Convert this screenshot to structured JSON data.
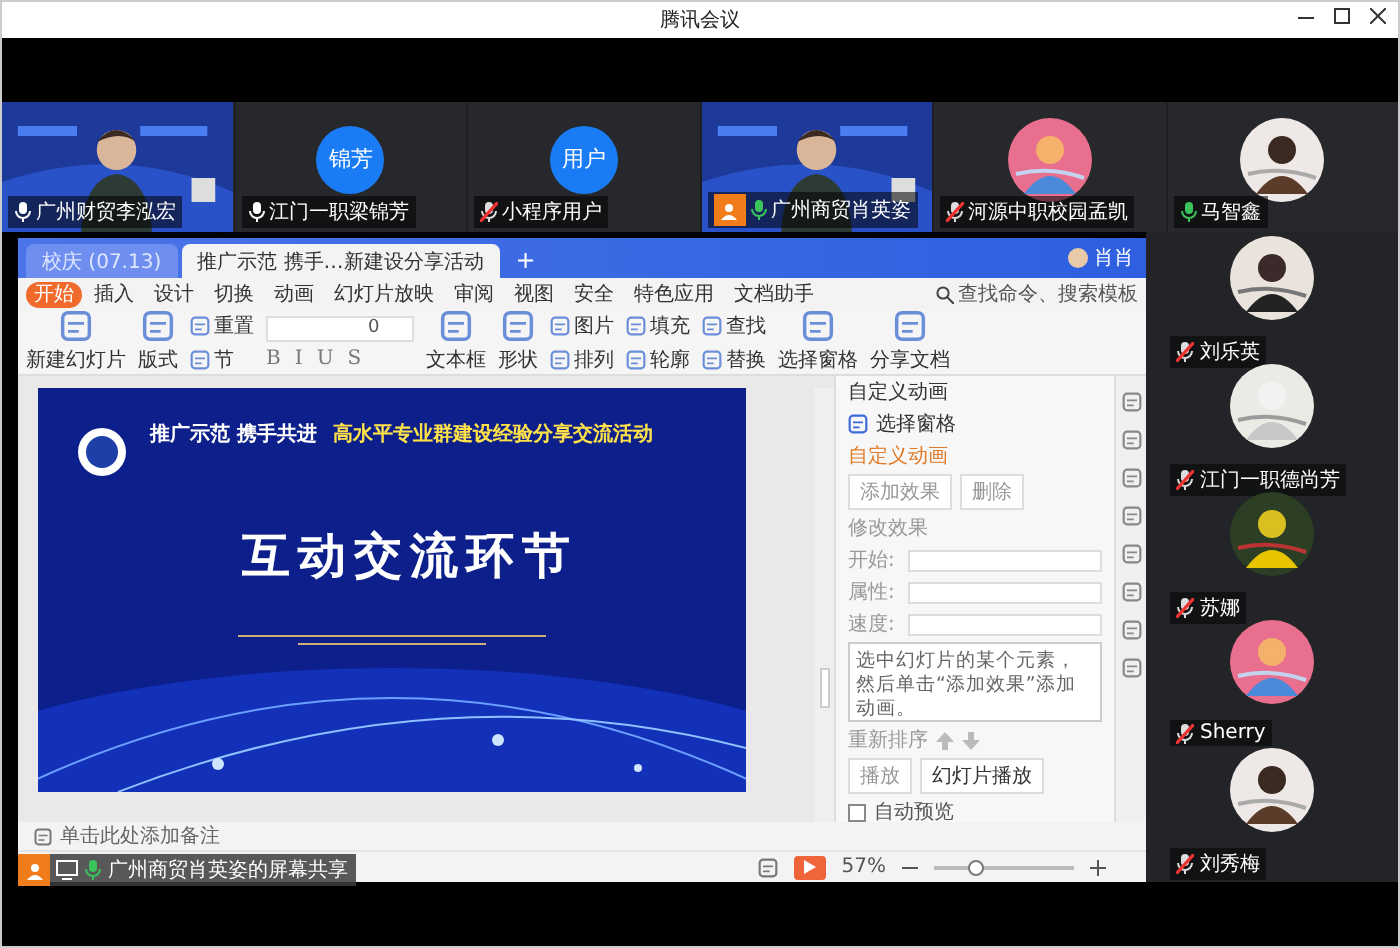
{
  "window": {
    "title": "腾讯会议"
  },
  "top_participants": [
    {
      "name": "广州财贸李泓宏",
      "kind": "video",
      "muted": false,
      "speaking": false,
      "host": false
    },
    {
      "name": "江门一职梁锦芳",
      "kind": "initials",
      "initials": "锦芳",
      "muted": false,
      "speaking": false,
      "host": false
    },
    {
      "name": "小程序用户",
      "kind": "initials",
      "initials": "用户",
      "muted": true,
      "speaking": false,
      "host": false
    },
    {
      "name": "广州商贸肖英姿",
      "kind": "video",
      "muted": false,
      "speaking": true,
      "host": true
    },
    {
      "name": "河源中职校园孟凯",
      "muted": true,
      "speaking": false,
      "host": false
    },
    {
      "name": "马智鑫",
      "muted": false,
      "speaking": true,
      "host": false
    }
  ],
  "wps": {
    "tabs": [
      {
        "label": "校庆 (07.13)",
        "selected": false
      },
      {
        "label": "推广示范 携手…新建设分享活动",
        "selected": true
      }
    ],
    "new_tab": "+",
    "user": "肖肖",
    "menu": [
      {
        "label": "开始",
        "selected": true
      },
      {
        "label": "插入",
        "selected": false
      },
      {
        "label": "设计",
        "selected": false
      },
      {
        "label": "切换",
        "selected": false
      },
      {
        "label": "动画",
        "selected": false
      },
      {
        "label": "幻灯片放映",
        "selected": false
      },
      {
        "label": "审阅",
        "selected": false
      },
      {
        "label": "视图",
        "selected": false
      },
      {
        "label": "安全",
        "selected": false
      },
      {
        "label": "特色应用",
        "selected": false
      },
      {
        "label": "文档助手",
        "selected": false
      }
    ],
    "search": {
      "placeholder": "查找命令、搜索模板"
    },
    "toolbar": [
      {
        "kind": "large",
        "label": "新建幻灯片"
      },
      {
        "kind": "large",
        "label": "版式"
      },
      {
        "kind": "pair",
        "labels": [
          "重置",
          "节"
        ]
      },
      {
        "kind": "font",
        "size": "0",
        "styles": [
          "B",
          "I",
          "U",
          "S"
        ]
      },
      {
        "kind": "large",
        "label": "文本框"
      },
      {
        "kind": "large",
        "label": "形状"
      },
      {
        "kind": "pair",
        "labels": [
          "图片",
          "排列"
        ]
      },
      {
        "kind": "pair",
        "labels": [
          "填充",
          "轮廓"
        ]
      },
      {
        "kind": "pair",
        "labels": [
          "查找",
          "替换"
        ]
      },
      {
        "kind": "large",
        "label": "选择窗格"
      },
      {
        "kind": "large",
        "label": "分享文档"
      }
    ],
    "slide": {
      "header_left": "推广示范  携手共进",
      "header_right": "高水平专业群建设经验分享交流活动",
      "title": "互动交流环节"
    },
    "notes": {
      "placeholder": "单击此处添加备注"
    },
    "zoom": {
      "reading": "57%",
      "level": 0.3
    },
    "panel": {
      "title": "自定义动画",
      "select_pane": "选择窗格",
      "section": "自定义动画",
      "add": "添加效果",
      "delete": "删除",
      "modify": "修改效果",
      "fields": [
        {
          "label": "开始:"
        },
        {
          "label": "属性:"
        },
        {
          "label": "速度:"
        }
      ],
      "hint": "选中幻灯片的某个元素，然后单击“添加效果”添加动画。",
      "reorder": "重新排序",
      "play": "播放",
      "slideshow": "幻灯片播放",
      "autopreview": {
        "label": "自动预览",
        "checked": false
      }
    }
  },
  "share_label": "广州商贸肖英姿的屏幕共享",
  "side_participants": [
    {
      "name": "刘乐英",
      "muted": true
    },
    {
      "name": "江门一职德尚芳",
      "muted": true
    },
    {
      "name": "苏娜",
      "muted": true
    },
    {
      "name": "Sherry",
      "muted": true
    },
    {
      "name": "刘秀梅",
      "muted": true
    }
  ]
}
